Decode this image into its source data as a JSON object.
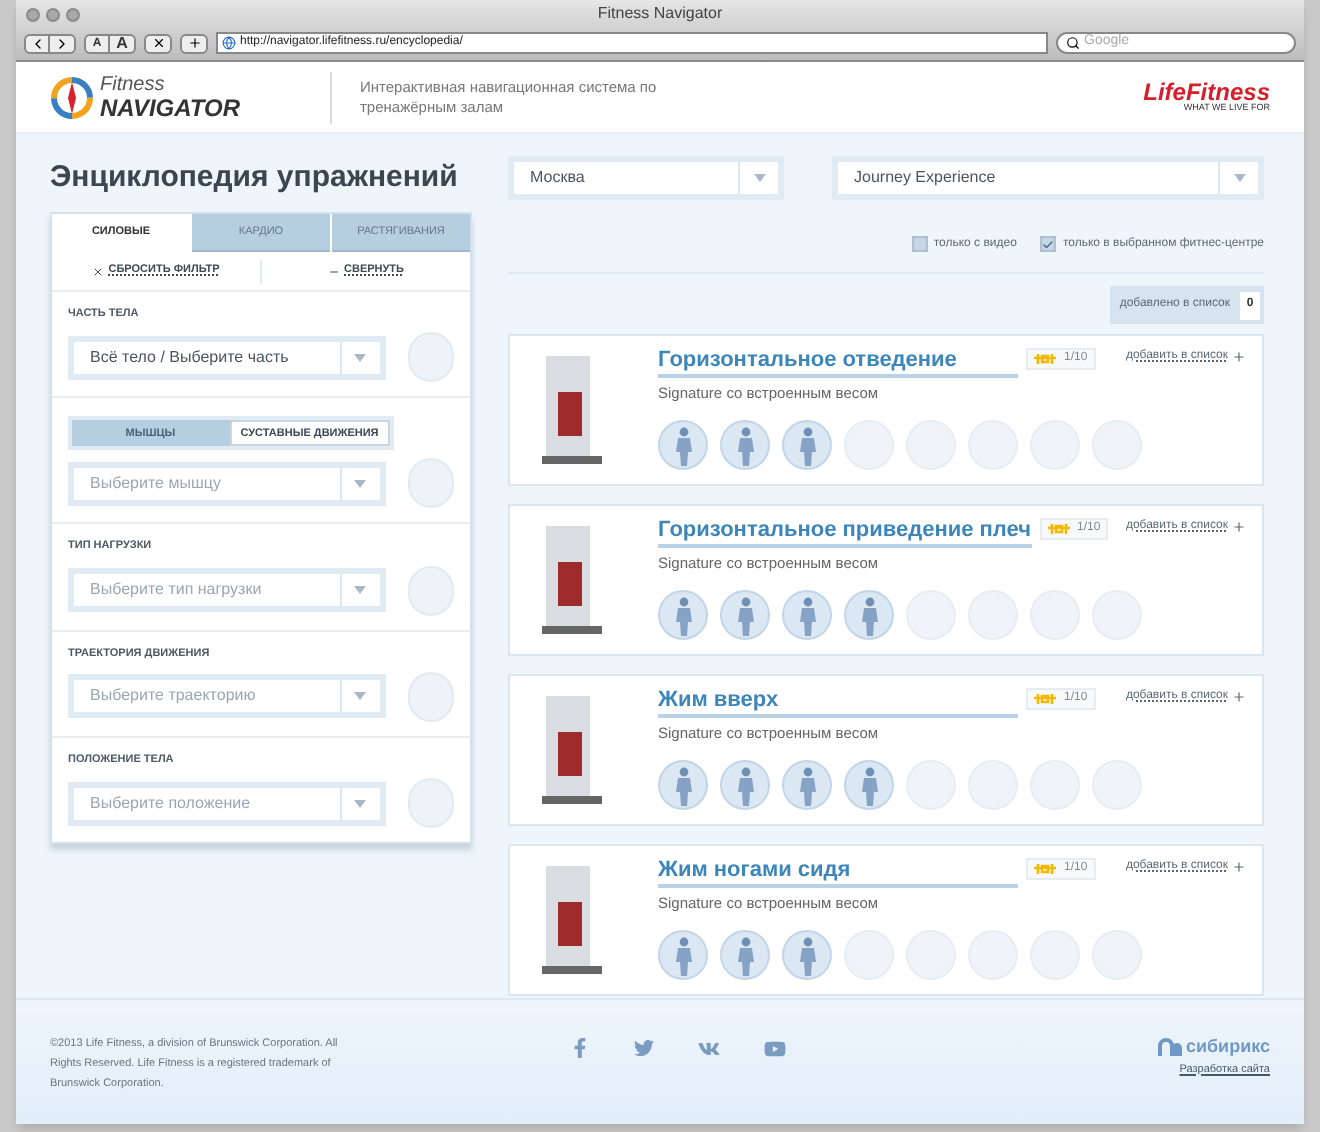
{
  "window": {
    "title": "Fitness Navigator"
  },
  "toolbar": {
    "text_buttons": [
      "A",
      "A"
    ],
    "url": "http://navigator.lifefitness.ru/encyclopedia/",
    "search_placeholder": "Google"
  },
  "header": {
    "logo_top": "Fitness",
    "logo_bottom": "NAVIGATOR",
    "tagline": "Интерактивная навигационная система по тренажёрным залам",
    "brand": "LifeFitness",
    "brand_slogan": "WHAT WE LIVE FOR"
  },
  "page_title": "Энциклопедия упражнений",
  "tabs": [
    {
      "label": "СИЛОВЫЕ",
      "selected": true
    },
    {
      "label": "КАРДИО",
      "selected": false
    },
    {
      "label": "РАСТЯГИВАНИЯ",
      "selected": false
    }
  ],
  "filter_actions": {
    "reset": "СБРОСИТЬ ФИЛЬТР",
    "collapse": "СВЕРНУТЬ"
  },
  "filters": [
    {
      "kind": "select",
      "label": "ЧАСТЬ ТЕЛА",
      "value": "Всё тело / Выберите часть"
    },
    {
      "kind": "segmented",
      "options": [
        {
          "label": "МЫШЦЫ",
          "selected": true
        },
        {
          "label": "СУСТАВНЫЕ ДВИЖЕНИЯ",
          "selected": false
        }
      ],
      "placeholder": "Выберите мышцу"
    },
    {
      "kind": "select",
      "label": "ТИП НАГРУЗКИ",
      "placeholder": "Выберите тип нагрузки"
    },
    {
      "kind": "select",
      "label": "ТРАЕКТОРИЯ ДВИЖЕНИЯ",
      "placeholder": "Выберите траекторию"
    },
    {
      "kind": "select",
      "label": "ПОЛОЖЕНИЕ ТЕЛА",
      "placeholder": "Выберите положение"
    }
  ],
  "city_select": {
    "value": "Москва"
  },
  "club_select": {
    "value": "Journey Experience"
  },
  "checkboxes": [
    {
      "label": "только с видео",
      "checked": false
    },
    {
      "label": "только в выбранном фитнес-центре",
      "checked": true
    }
  ],
  "list_counter": {
    "label": "добавлено в список",
    "count": "0"
  },
  "exercises": [
    {
      "title": "Горизонтальное отведение",
      "subtitle": "Signature со встроенным весом",
      "rating": "1/10",
      "add": "добавить в список",
      "icons": [
        {
          "kind": "figure"
        },
        {
          "kind": "figure"
        },
        {
          "kind": "figure"
        },
        {
          "kind": "empty"
        },
        {
          "kind": "empty"
        },
        {
          "kind": "empty"
        },
        {
          "kind": "empty"
        },
        {
          "kind": "empty"
        }
      ]
    },
    {
      "title": "Горизонтальное приведение плеч",
      "subtitle": "Signature со встроенным весом",
      "rating": "1/10",
      "add": "добавить в список",
      "icons": [
        {
          "kind": "figure"
        },
        {
          "kind": "figure"
        },
        {
          "kind": "figure"
        },
        {
          "kind": "figure"
        },
        {
          "kind": "empty"
        },
        {
          "kind": "empty"
        },
        {
          "kind": "empty"
        },
        {
          "kind": "empty"
        }
      ]
    },
    {
      "title": "Жим вверх",
      "subtitle": "Signature со встроенным весом",
      "rating": "1/10",
      "add": "добавить в список",
      "icons": [
        {
          "kind": "figure"
        },
        {
          "kind": "figure"
        },
        {
          "kind": "figure"
        },
        {
          "kind": "figure"
        },
        {
          "kind": "empty"
        },
        {
          "kind": "empty"
        },
        {
          "kind": "empty"
        },
        {
          "kind": "empty"
        }
      ]
    },
    {
      "title": "Жим ногами сидя",
      "subtitle": "Signature со встроенным весом",
      "rating": "1/10",
      "add": "добавить в список",
      "icons": [
        {
          "kind": "figure"
        },
        {
          "kind": "figure"
        },
        {
          "kind": "figure"
        },
        {
          "kind": "empty"
        },
        {
          "kind": "empty"
        },
        {
          "kind": "empty"
        },
        {
          "kind": "empty"
        },
        {
          "kind": "empty"
        }
      ]
    }
  ],
  "footer": {
    "copyright": "©2013 Life Fitness, a division of Brunswick Corporation. All Rights Reserved. Life Fitness is a registered trademark of Brunswick Corporation.",
    "developer": "сибирикс",
    "developer_link": "Разработка сайта"
  }
}
